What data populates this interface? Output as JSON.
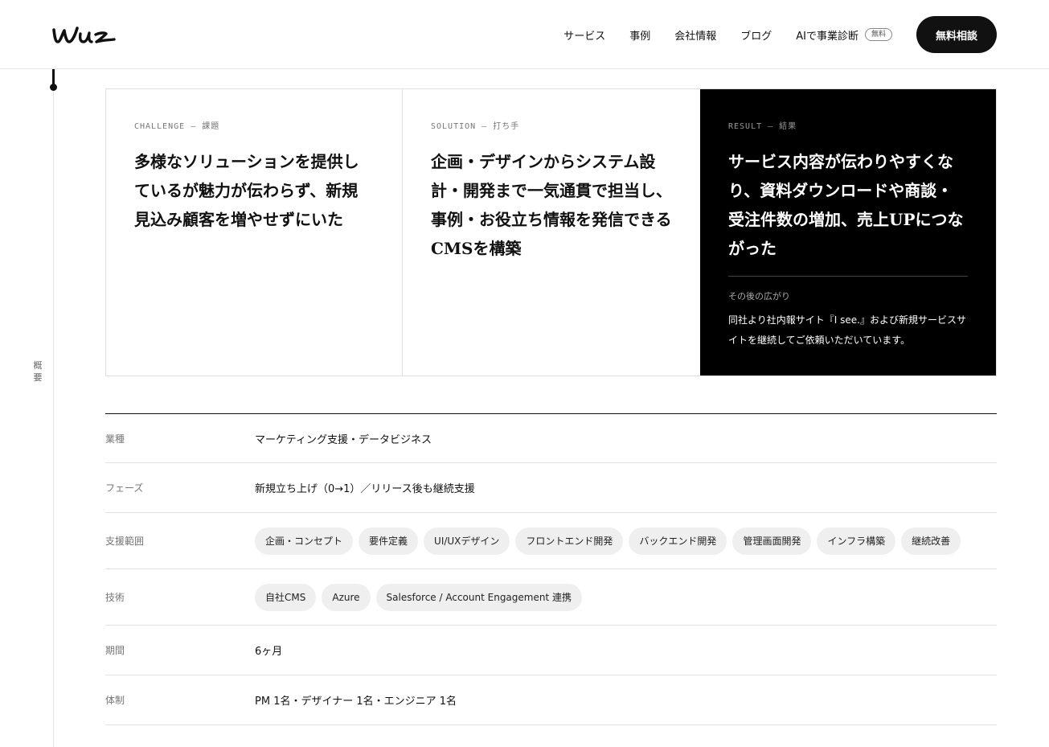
{
  "header": {
    "logo_text": "Wuz",
    "nav": [
      {
        "label": "サービス"
      },
      {
        "label": "事例"
      },
      {
        "label": "会社情報"
      },
      {
        "label": "ブログ"
      },
      {
        "label": "AIで事業診断",
        "badge": "無料"
      }
    ],
    "cta_label": "無料相談"
  },
  "rail": {
    "section_label": "概要"
  },
  "cards": [
    {
      "tag": "CHALLENGE — 課題",
      "title": "多様なソリューションを提供しているが魅力が伝わらず、新規見込み顧客を増やせずにいた"
    },
    {
      "tag": "SOLUTION — 打ち手",
      "title": "企画・デザインからシステム設計・開発まで一気通貫で担当し、事例・お役立ち情報を発信できるCMSを構築"
    },
    {
      "tag": "RESULT — 結果",
      "title": "サービス内容が伝わりやすくなり、資料ダウンロードや商談・受注件数の増加、売上UPにつながった",
      "sub_label": "その後の広がり",
      "note": "同社より社内報サイト『I see.』および新規サービスサイトを継続してご依頼いただいています。"
    }
  ],
  "info": {
    "industry": {
      "label": "業種",
      "value": "マーケティング支援・データビジネス"
    },
    "phase": {
      "label": "フェーズ",
      "value": "新規立ち上げ（0→1）／リリース後も継続支援"
    },
    "scope": {
      "label": "支援範囲",
      "tags": [
        "企画・コンセプト",
        "要件定義",
        "UI/UXデザイン",
        "フロントエンド開発",
        "バックエンド開発",
        "管理画面開発",
        "インフラ構築",
        "継続改善"
      ]
    },
    "tech": {
      "label": "技術",
      "tags": [
        "自社CMS",
        "Azure",
        "Salesforce / Account Engagement 連携"
      ]
    },
    "period": {
      "label": "期間",
      "value": "6ヶ月"
    },
    "team": {
      "label": "体制",
      "value": "PM 1名・デザイナー 1名・エンジニア 1名"
    }
  },
  "colors": {
    "accent": "#111111",
    "result_bg": "#000000",
    "tag_bg": "#efefef"
  }
}
